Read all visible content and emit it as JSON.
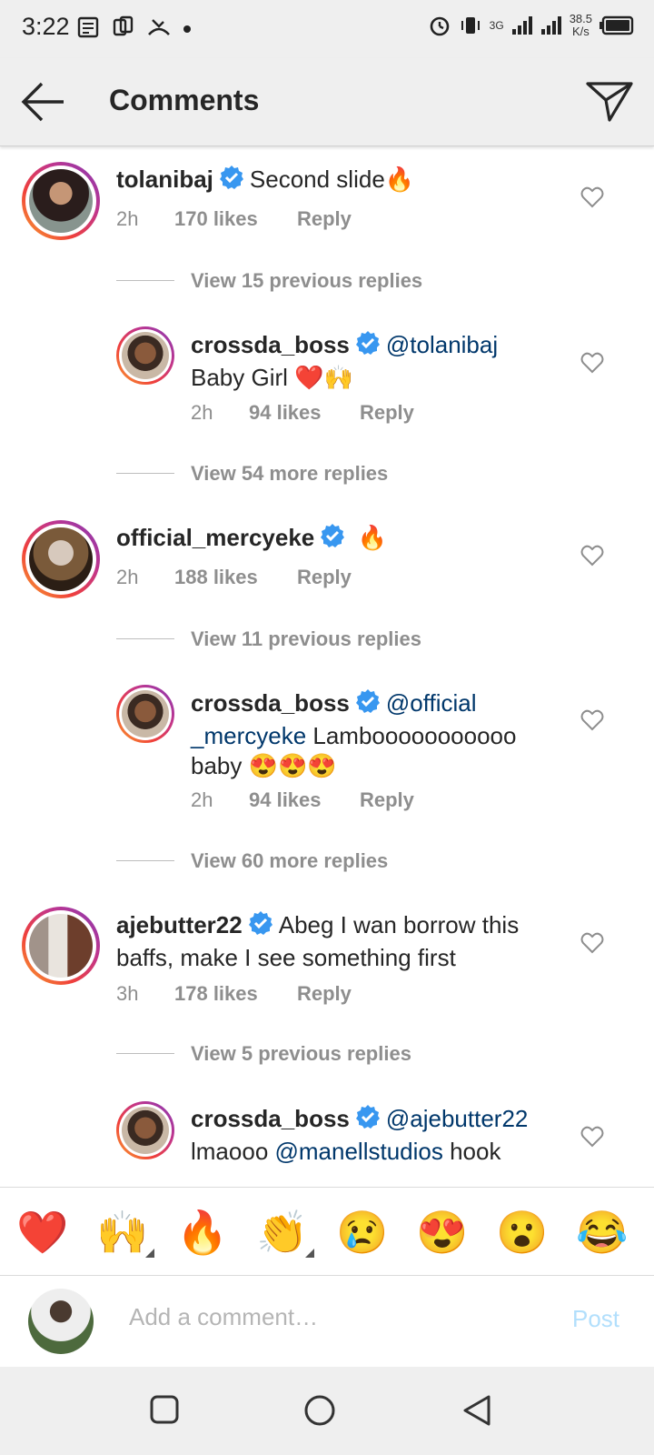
{
  "status_bar": {
    "time": "3:22",
    "speed_value": "38.5",
    "speed_unit": "K/s",
    "signal_label": "3G"
  },
  "header": {
    "title": "Comments"
  },
  "comments": [
    {
      "username": "tolanibaj",
      "text": "Second slide",
      "emoji": "🔥",
      "time": "2h",
      "likes": "170 likes",
      "reply": "Reply"
    },
    {
      "username": "official_mercyeke",
      "text": "",
      "emoji": "🔥",
      "time": "2h",
      "likes": "188 likes",
      "reply": "Reply"
    },
    {
      "username": "ajebutter22",
      "text_line1": "Abeg I wan borrow this",
      "text_line2": "baffs, make I see something first",
      "time": "3h",
      "likes": "178 likes",
      "reply": "Reply"
    }
  ],
  "replies": [
    {
      "username": "crossda_boss",
      "mention": "@tolanibaj",
      "text": "Baby Girl",
      "emoji": "❤️🙌",
      "time": "2h",
      "likes": "94 likes",
      "reply": "Reply"
    },
    {
      "username": "crossda_boss",
      "mention_line1": "@official",
      "mention_line2": "_mercyeke",
      "text_line2": " Lambooooooooooo",
      "text_line3": "baby",
      "emoji": "😍😍😍",
      "time": "2h",
      "likes": "94 likes",
      "reply": "Reply"
    },
    {
      "username": "crossda_boss",
      "mention": "@ajebutter22",
      "mention2": "lmaooo ",
      "mention3": "@manellstudios",
      "text": " hook"
    }
  ],
  "view_links": [
    "View 15 previous replies",
    "View 54 more replies",
    "View 11 previous replies",
    "View 60 more replies",
    "View 5 previous replies"
  ],
  "emoji_bar": [
    "❤️",
    "🙌",
    "🔥",
    "👏",
    "😢",
    "😍",
    "😮",
    "😂"
  ],
  "compose": {
    "placeholder": "Add a comment…",
    "post": "Post"
  },
  "colors": {
    "verified": "#3897f0",
    "mention": "#00376b",
    "muted": "#8e8e8e",
    "post_disabled": "#b2dffc"
  }
}
